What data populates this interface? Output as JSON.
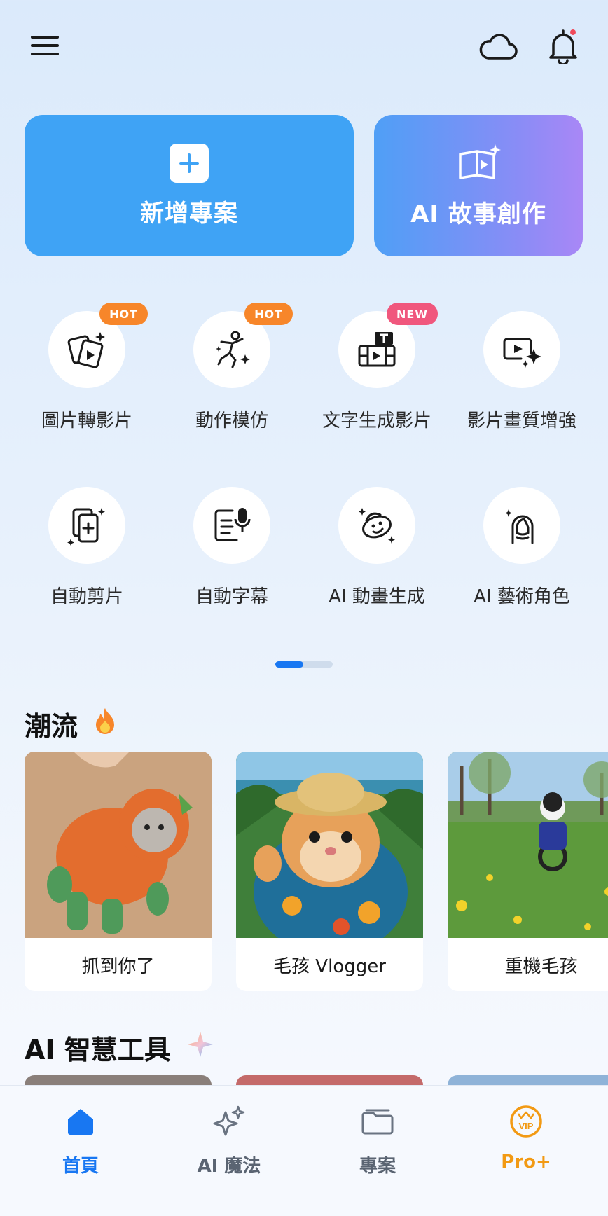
{
  "header": {
    "menu_icon": "hamburger-menu-icon",
    "cloud_icon": "cloud-icon",
    "bell_icon": "bell-icon",
    "notification_dot_color": "#f04a5a"
  },
  "hero": {
    "new_project_label": "新增專案",
    "ai_story_label": "AI 故事創作",
    "new_project_color": "#3fa3f5",
    "ai_story_gradient": [
      "#4f9ff6",
      "#a987f6"
    ]
  },
  "tools": [
    {
      "label": "圖片轉影片",
      "icon": "photo-to-video-icon",
      "badge": "HOT"
    },
    {
      "label": "動作模仿",
      "icon": "motion-dance-icon",
      "badge": "HOT"
    },
    {
      "label": "文字生成影片",
      "icon": "text-to-video-icon",
      "badge": "NEW"
    },
    {
      "label": "影片畫質增強",
      "icon": "video-enhance-icon",
      "badge": ""
    },
    {
      "label": "自動剪片",
      "icon": "auto-cut-icon",
      "badge": ""
    },
    {
      "label": "自動字幕",
      "icon": "auto-caption-icon",
      "badge": ""
    },
    {
      "label": "AI 動畫生成",
      "icon": "ai-animation-icon",
      "badge": ""
    },
    {
      "label": "AI 藝術角色",
      "icon": "ai-art-character-icon",
      "badge": ""
    }
  ],
  "pager": {
    "current_page": 1,
    "total_pages": 2,
    "active_color": "#1877f2"
  },
  "trending": {
    "title": "潮流",
    "emoji_icon": "fire-icon",
    "items": [
      {
        "label": "抓到你了",
        "thumbnail": "cat-in-orange-costume"
      },
      {
        "label": "毛孩 Vlogger",
        "thumbnail": "hamster-with-straw-hat"
      },
      {
        "label": "重機毛孩",
        "thumbnail": "cat-on-motorcycle"
      }
    ]
  },
  "ai_tools": {
    "title": "AI 智慧工具",
    "emoji_icon": "sparkle-icon"
  },
  "bottom_nav": {
    "items": [
      {
        "label": "首頁",
        "icon": "home-icon",
        "active": true
      },
      {
        "label": "AI 魔法",
        "icon": "ai-magic-sparkle-icon",
        "active": false
      },
      {
        "label": "專案",
        "icon": "folder-icon",
        "active": false
      },
      {
        "label": "Pro+",
        "icon": "vip-badge-icon",
        "active": false
      }
    ],
    "active_color": "#1877f2",
    "pro_color": "#f29a14"
  }
}
